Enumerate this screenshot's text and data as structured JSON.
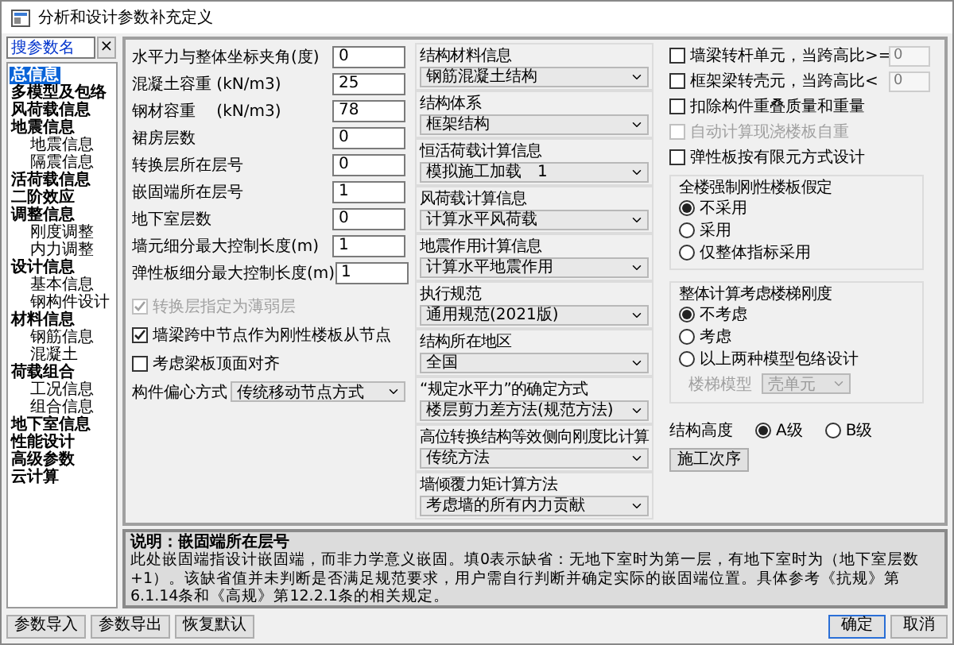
{
  "window": {
    "title": "分析和设计参数补充定义"
  },
  "search": {
    "placeholder": "搜参数名",
    "clear": "×"
  },
  "tree": [
    {
      "label": "总信息",
      "selected": true
    },
    {
      "label": "多模型及包络",
      "selected": false
    },
    {
      "label": "风荷载信息",
      "selected": false
    },
    {
      "label": "地震信息",
      "selected": false,
      "children": [
        {
          "label": "地震信息",
          "selected": false
        },
        {
          "label": "隔震信息",
          "selected": false
        }
      ]
    },
    {
      "label": "活荷载信息",
      "selected": false
    },
    {
      "label": "二阶效应",
      "selected": false
    },
    {
      "label": "调整信息",
      "selected": false,
      "children": [
        {
          "label": "刚度调整",
          "selected": false
        },
        {
          "label": "内力调整",
          "selected": false
        }
      ]
    },
    {
      "label": "设计信息",
      "selected": false,
      "children": [
        {
          "label": "基本信息",
          "selected": false
        },
        {
          "label": "钢构件设计",
          "selected": false
        }
      ]
    },
    {
      "label": "材料信息",
      "selected": false,
      "children": [
        {
          "label": "钢筋信息",
          "selected": false
        },
        {
          "label": "混凝土",
          "selected": false
        }
      ]
    },
    {
      "label": "荷载组合",
      "selected": false,
      "children": [
        {
          "label": "工况信息",
          "selected": false
        },
        {
          "label": "组合信息",
          "selected": false
        }
      ]
    },
    {
      "label": "地下室信息",
      "selected": false
    },
    {
      "label": "性能设计",
      "selected": false
    },
    {
      "label": "高级参数",
      "selected": false
    },
    {
      "label": "云计算",
      "selected": false
    }
  ],
  "fields": [
    {
      "label": "水平力与整体坐标夹角(度)",
      "value": "0"
    },
    {
      "label": "混凝土容重 (kN/m3)",
      "value": "25"
    },
    {
      "label": "钢材容重　 (kN/m3)",
      "value": "78"
    },
    {
      "label": "裙房层数",
      "value": "0"
    },
    {
      "label": "转换层所在层号",
      "value": "0"
    },
    {
      "label": "嵌固端所在层号",
      "value": "1"
    },
    {
      "label": "地下室层数",
      "value": "0"
    },
    {
      "label": "墙元细分最大控制长度(m)",
      "value": "1"
    },
    {
      "label": "弹性板细分最大控制长度(m)",
      "value": "1"
    }
  ],
  "left_checks": [
    {
      "label": "转换层指定为薄弱层",
      "checked": true,
      "disabled": true
    },
    {
      "label": "墙梁跨中节点作为刚性楼板从节点",
      "checked": true,
      "disabled": false
    },
    {
      "label": "考虑梁板顶面对齐",
      "checked": false,
      "disabled": false
    }
  ],
  "eccentric": {
    "label": "构件偏心方式",
    "value": "传统移动节点方式"
  },
  "groups": [
    {
      "title": "结构材料信息",
      "value": "钢筋混凝土结构"
    },
    {
      "title": "结构体系",
      "value": "框架结构"
    },
    {
      "title": "恒活荷载计算信息",
      "value": "模拟施工加载　1"
    },
    {
      "title": "风荷载计算信息",
      "value": "计算水平风荷载"
    },
    {
      "title": "地震作用计算信息",
      "value": "计算水平地震作用"
    },
    {
      "title": "执行规范",
      "value": "通用规范(2021版)"
    },
    {
      "title": "结构所在地区",
      "value": "全国"
    },
    {
      "title": "“规定水平力”的确定方式",
      "value": "楼层剪力差方法(规范方法)"
    },
    {
      "title": "高位转换结构等效侧向刚度比计算",
      "value": "传统方法"
    },
    {
      "title": "墙倾覆力矩计算方法",
      "value": "考虑墙的所有内力贡献"
    }
  ],
  "right_checks": [
    {
      "label": "墙梁转杆单元，当跨高比>=",
      "checked": false,
      "disabled": false,
      "value": "0"
    },
    {
      "label": "框架梁转壳元，当跨高比<",
      "checked": false,
      "disabled": false,
      "value": "0"
    },
    {
      "label": "扣除构件重叠质量和重量",
      "checked": false,
      "disabled": false
    },
    {
      "label": "自动计算现浇楼板自重",
      "checked": false,
      "disabled": true
    },
    {
      "label": "弹性板按有限元方式设计",
      "checked": false,
      "disabled": false
    }
  ],
  "rigid_floor": {
    "title": "全楼强制刚性楼板假定",
    "options": [
      {
        "label": "不采用",
        "selected": true
      },
      {
        "label": "采用",
        "selected": false
      },
      {
        "label": "仅整体指标采用",
        "selected": false
      }
    ]
  },
  "stair": {
    "title": "整体计算考虑楼梯刚度",
    "options": [
      {
        "label": "不考虑",
        "selected": true
      },
      {
        "label": "考虑",
        "selected": false
      },
      {
        "label": "以上两种模型包络设计",
        "selected": false
      }
    ],
    "model": {
      "label": "楼梯模型",
      "value": "壳单元",
      "disabled": true
    }
  },
  "height": {
    "label": "结构高度",
    "options": [
      {
        "label": "A级",
        "selected": true
      },
      {
        "label": "B级",
        "selected": false
      }
    ]
  },
  "sequence_button": "施工次序",
  "description": {
    "title": "说明：嵌固端所在层号",
    "text": "此处嵌固端指设计嵌固端，而非力学意义嵌固。填0表示缺省：无地下室时为第一层，有地下室时为（地下室层数+1）。该缺省值并未判断是否满足规范要求，用户需自行判断并确定实际的嵌固端位置。具体参考《抗规》第6.1.14条和《高规》第12.2.1条的相关规定。"
  },
  "footer_left": [
    {
      "label": "参数导入",
      "default": false
    },
    {
      "label": "参数导出",
      "default": false
    },
    {
      "label": "恢复默认",
      "default": false
    }
  ],
  "footer_right": [
    {
      "label": "确定",
      "default": true
    },
    {
      "label": "取消",
      "default": false
    }
  ]
}
